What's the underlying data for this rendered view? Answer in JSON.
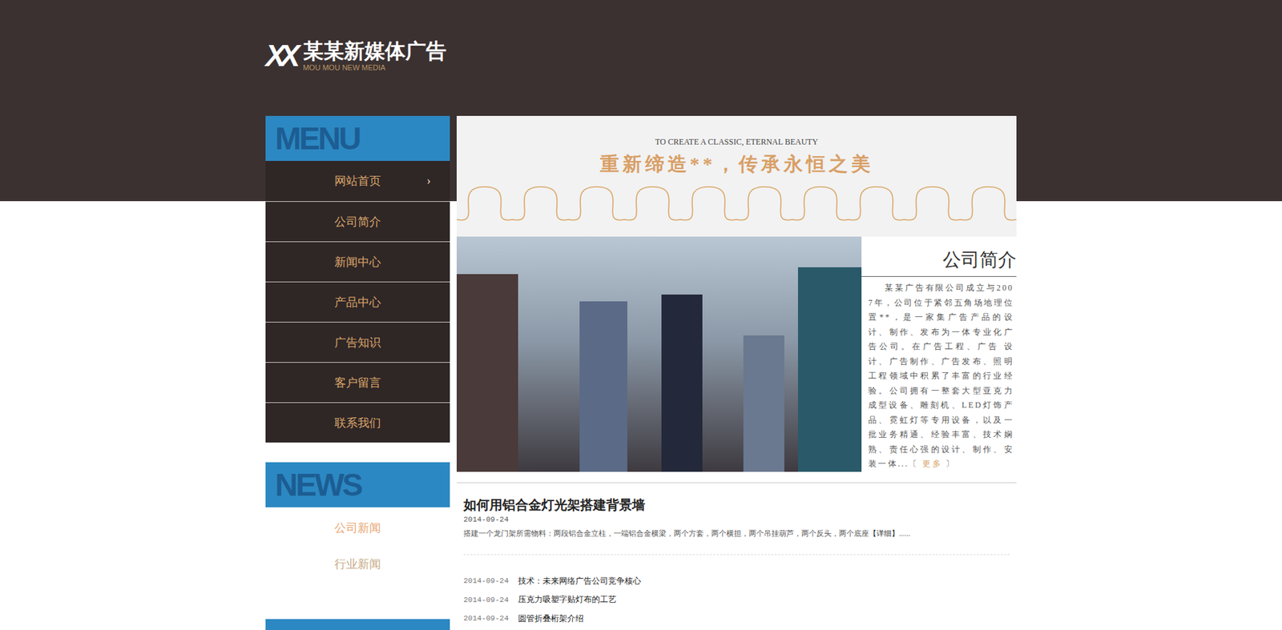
{
  "logo": {
    "mark": "XX",
    "title": "某某新媒体广告",
    "subtitle": "MOU MOU NEW MEDIA"
  },
  "menu": {
    "heading": "MENU",
    "arrow": "›",
    "items": [
      {
        "label": "网站首页",
        "selected": true
      },
      {
        "label": "公司简介",
        "selected": false
      },
      {
        "label": "新闻中心",
        "selected": false
      },
      {
        "label": "产品中心",
        "selected": false
      },
      {
        "label": "广告知识",
        "selected": false
      },
      {
        "label": "客户留言",
        "selected": false
      },
      {
        "label": "联系我们",
        "selected": false
      }
    ]
  },
  "banner": {
    "eyebrow": "TO CREATE A CLASSIC, ETERNAL BEAUTY",
    "slogan": "重新缔造**，传承永恒之美"
  },
  "about": {
    "title": "公司简介",
    "body": "某某广告有限公司成立与2007年，公司位于紧邻五角场地理位置**，是一家集广告产品的设计、制作、发布为一体专业化广告公司。在广告工程、广告 设计、广告制作、广告发布、照明工程领域中积累了丰富的行业经验。公司拥有一整套大型亚克力成型设备、雕刻机、LED灯饰产品、霓虹灯等专用设备，以及一 批业务精通、经验丰富、技术娴熟、责任心强的设计、制作、安装一体...",
    "more_open": "〔",
    "more": "更多",
    "more_close": "〕"
  },
  "feature": {
    "title": "如何用铝合金灯光架搭建背景墙",
    "date": "2014-09-24",
    "summary": "搭建一个龙门架所需物料：两段铝合金立柱，一端铝合金横梁，两个方套，两个横担，两个吊挂葫芦，两个反头，两个底座",
    "detail": "【详细】",
    "ellipsis": "......"
  },
  "news_list": [
    {
      "date": "2014-09-24",
      "title": "技术：未来网络广告公司竞争核心"
    },
    {
      "date": "2014-09-24",
      "title": "压克力吸塑字贴灯布的工艺"
    },
    {
      "date": "2014-09-24",
      "title": "圆管折叠桁架介绍"
    }
  ],
  "news": {
    "heading": "NEWS",
    "categories": [
      {
        "label": "公司新闻",
        "selected": true
      },
      {
        "label": "行业新闻",
        "selected": false
      }
    ]
  }
}
